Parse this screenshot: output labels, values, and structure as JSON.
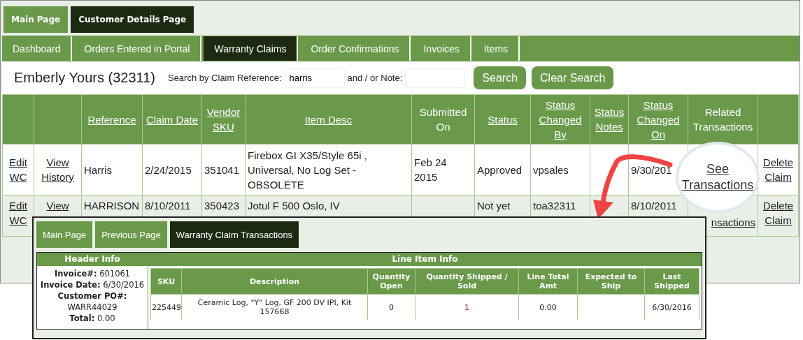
{
  "top_tabs": [
    {
      "label": "Main Page",
      "selected": false
    },
    {
      "label": "Customer Details Page",
      "selected": true
    }
  ],
  "nav_tabs": [
    {
      "label": "Dashboard",
      "selected": false
    },
    {
      "label": "Orders Entered in Portal",
      "selected": false
    },
    {
      "label": "Warranty Claims",
      "selected": true
    },
    {
      "label": "Order Confirmations",
      "selected": false
    },
    {
      "label": "Invoices",
      "selected": false
    },
    {
      "label": "Items",
      "selected": false
    }
  ],
  "customer_title": "Emberly Yours (32311)",
  "search": {
    "reference_label": "Search by Claim Reference:",
    "reference_value": "harris",
    "note_label": "and / or Note:",
    "search_button": "Search",
    "clear_button": "Clear Search"
  },
  "table": {
    "columns": [
      null,
      null,
      {
        "text": "Reference",
        "link": true
      },
      {
        "text": "Claim Date",
        "link": true
      },
      {
        "text": "Vendor SKU",
        "link": true
      },
      {
        "text": "Item Desc",
        "link": true
      },
      {
        "text": "Submitted On",
        "link": false
      },
      {
        "text": "Status",
        "link": true
      },
      {
        "text": "Status Changed By",
        "link": true
      },
      {
        "text": "Status Notes",
        "link": true
      },
      {
        "text": "Status Changed On",
        "link": true
      },
      {
        "text": "Related Transactions",
        "link": false
      },
      null
    ],
    "rows": [
      {
        "cells": [
          {
            "text": "Edit WC",
            "link": true
          },
          {
            "text": "View History",
            "link": true
          },
          {
            "text": "Harris",
            "link": false
          },
          {
            "text": "2/24/2015",
            "link": false
          },
          {
            "text": "351041",
            "link": false
          },
          {
            "text": "Firebox GI X35/Style 65i , Universal, No Log Set - OBSOLETE",
            "link": false
          },
          {
            "text": "Feb 24 2015",
            "link": false
          },
          {
            "text": "Approved",
            "link": false
          },
          {
            "text": "vpsales",
            "link": false
          },
          null,
          {
            "text": "9/30/201",
            "link": false
          },
          null,
          {
            "text": "Delete Claim",
            "link": true
          }
        ]
      },
      {
        "cells": [
          {
            "text": "Edit WC",
            "link": true
          },
          {
            "text": "View",
            "link": true
          },
          {
            "text": "HARRISON",
            "link": false
          },
          {
            "text": "8/10/2011",
            "link": false
          },
          {
            "text": "350423",
            "link": false
          },
          {
            "text": "Jotul F 500 Oslo, IV",
            "link": false
          },
          null,
          {
            "text": "Not yet",
            "link": false
          },
          {
            "text": "toa32311",
            "link": false
          },
          null,
          {
            "text": "8/10/2011",
            "link": false
          },
          {
            "text": "nsactions",
            "link": true
          },
          {
            "text": "Delete Claim",
            "link": true
          }
        ]
      }
    ]
  },
  "magnifier": {
    "link": "See Transactions"
  },
  "popup": {
    "tabs": [
      {
        "label": "Main Page",
        "selected": false
      },
      {
        "label": "Previous Page",
        "selected": false
      },
      {
        "label": "Warranty Claim Transactions",
        "selected": true
      }
    ],
    "header_title": "Header Info",
    "header_fields": [
      {
        "label": "Invoice#:",
        "value": "601061",
        "break": false
      },
      {
        "label": "Invoice Date:",
        "value": "6/30/2016",
        "break": false
      },
      {
        "label": "Customer PO#:",
        "value": "WARR44029",
        "break": true
      },
      {
        "label": "Total:",
        "value": "0.00",
        "break": false
      }
    ],
    "line_title": "Line Item Info",
    "columns": [
      "SKU",
      "Description",
      "Quantity Open",
      "Quantity Shipped / Sold",
      "Line Total Amt",
      "Expected to Ship",
      "Last Shipped"
    ],
    "rows": [
      {
        "cells": [
          "225449",
          "Ceramic Log, \"Y\" Log, GF 200 DV IPI, Kit 157668",
          "0",
          "1",
          "0.00",
          null,
          "6/30/2016"
        ]
      }
    ]
  }
}
